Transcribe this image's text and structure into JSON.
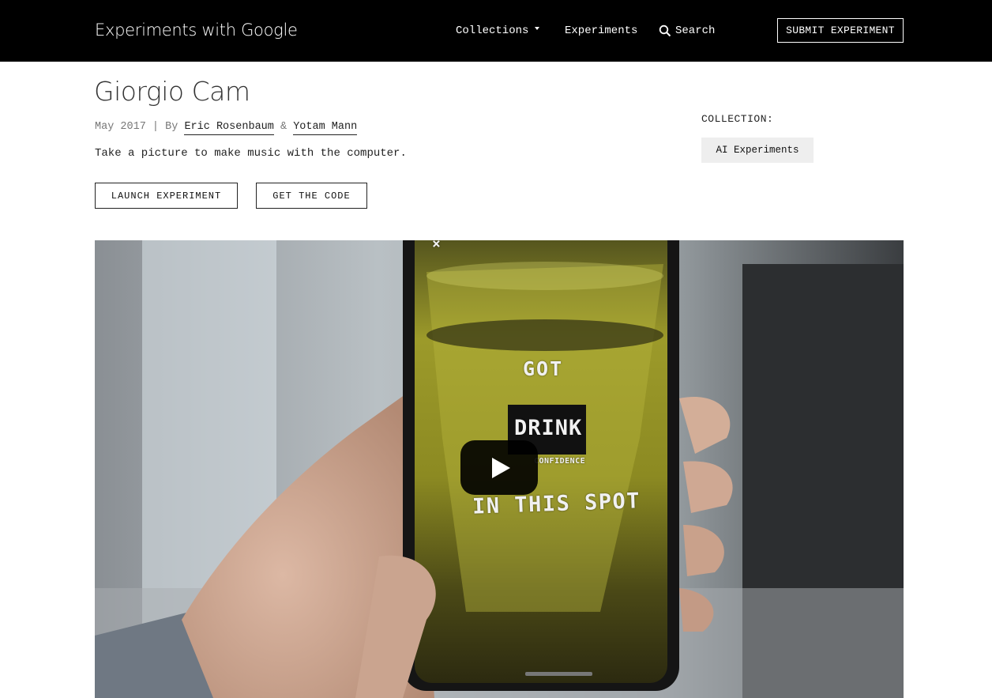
{
  "header": {
    "brand": "Experiments with Google",
    "nav": {
      "collections": "Collections",
      "experiments": "Experiments",
      "search_placeholder": "Search",
      "submit": "SUBMIT EXPERIMENT"
    }
  },
  "experiment": {
    "title": "Giorgio Cam",
    "date": "May 2017",
    "separator": "|",
    "by": "By",
    "authors": [
      "Eric Rosenbaum",
      "Yotam Mann"
    ],
    "author_joiner": "&",
    "description": "Take a picture to make music with the computer.",
    "buttons": {
      "launch": "LAUNCH EXPERIMENT",
      "code": "GET THE CODE"
    },
    "collection_label": "COLLECTION:",
    "collection_tag": "AI Experiments"
  },
  "video": {
    "overlay_text": {
      "close": "×",
      "line1": "GOT",
      "line2": "DRINK",
      "line3": "CONFIDENCE",
      "line4": "IN THIS SPOT"
    }
  },
  "colors": {
    "header_bg": "#000000",
    "header_text": "#ffffff",
    "tag_bg": "#eeeeee",
    "play_button": "#000000"
  },
  "icons": {
    "search": "search-icon",
    "dropdown": "caret-down-icon",
    "play": "play-icon"
  }
}
